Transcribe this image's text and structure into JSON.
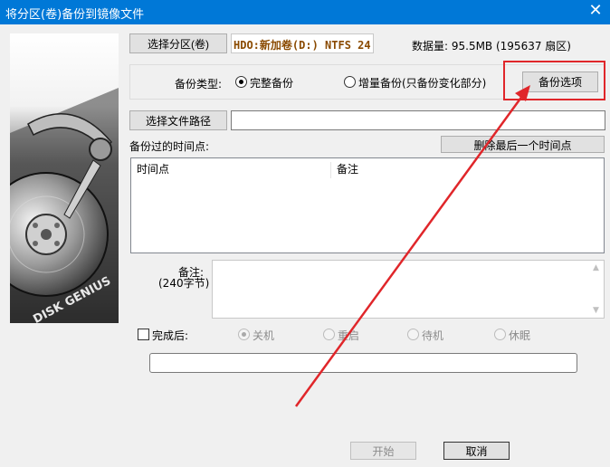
{
  "window": {
    "title": "将分区(卷)备份到镜像文件",
    "close_glyph": "✕"
  },
  "partition": {
    "select_button": "选择分区(卷)",
    "selected_text": "HDO:新加卷(D:) NTFS 24.",
    "data_size": "数据量: 95.5MB (195637 扇区)"
  },
  "backup_type": {
    "label": "备份类型:",
    "options": [
      "完整备份",
      "增量备份(只备份变化部分)"
    ],
    "selected": 0,
    "options_button": "备份选项"
  },
  "file_path": {
    "button": "选择文件路径",
    "value": ""
  },
  "timepoints": {
    "label": "备份过的时间点:",
    "delete_button": "删除最后一个时间点",
    "columns": [
      "时间点",
      "备注"
    ],
    "rows": []
  },
  "note": {
    "label": "备注:",
    "hint": "(240字节)",
    "value": ""
  },
  "after_complete": {
    "checkbox_label": "完成后:",
    "checked": false,
    "options": [
      "关机",
      "重启",
      "待机",
      "休眠"
    ],
    "selected": 0
  },
  "status_field": {
    "value": ""
  },
  "footer": {
    "start_button": "开始",
    "cancel_button": "取消"
  },
  "logo": {
    "text": "DISK GENIUS"
  },
  "colors": {
    "title_bar": "#0078d7",
    "highlight_border": "#e0262a",
    "annotation_arrow": "#e0262a",
    "partition_text": "#8a4a00"
  }
}
